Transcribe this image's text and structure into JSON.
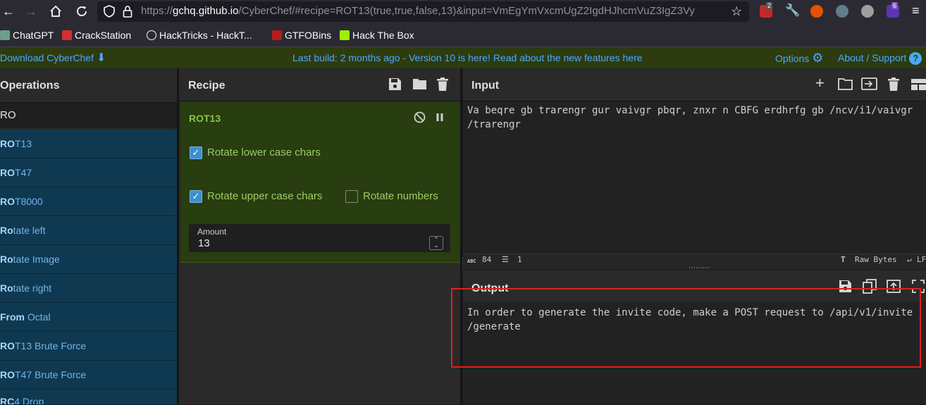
{
  "browser": {
    "url_prefix": "https://",
    "url_host": "gchq.github.io",
    "url_rest": "/CyberChef/#recipe=ROT13(true,true,false,13)&input=VmEgYmVxcmUgZ2IgdHJhcmVuZ3IgZ3Vy",
    "ext_badge_1": "2",
    "ext_badge_2": "6"
  },
  "bookmarks": [
    {
      "label": "ChatGPT"
    },
    {
      "label": "CrackStation"
    },
    {
      "label": "HackTricks - HackT..."
    },
    {
      "label": "GTFOBins"
    },
    {
      "label": "Hack The Box"
    }
  ],
  "banner": {
    "download": "Download CyberChef",
    "build_info": "Last build: 2 months ago - Version 10 is here! Read about the new features here",
    "options": "Options",
    "about": "About / Support"
  },
  "operations": {
    "title": "Operations",
    "search_value": "RO",
    "items": [
      {
        "match": "RO",
        "rest": "T13"
      },
      {
        "match": "RO",
        "rest": "T47"
      },
      {
        "match": "RO",
        "rest": "T8000"
      },
      {
        "match": "Ro",
        "rest": "tate left"
      },
      {
        "match": "Ro",
        "rest": "tate Image"
      },
      {
        "match": "Ro",
        "rest": "tate right"
      },
      {
        "match": "From ",
        "rest": "Octal"
      },
      {
        "match": "RO",
        "rest": "T13 Brute Force"
      },
      {
        "match": "RO",
        "rest": "T47 Brute Force"
      },
      {
        "match": "RC",
        "rest": "4 Drop"
      }
    ]
  },
  "recipe": {
    "title": "Recipe",
    "operation": "ROT13",
    "opt_lower": "Rotate lower case chars",
    "opt_upper": "Rotate upper case chars",
    "opt_numbers": "Rotate numbers",
    "lower_checked": true,
    "upper_checked": true,
    "numbers_checked": false,
    "amount_label": "Amount",
    "amount_value": "13"
  },
  "input": {
    "title": "Input",
    "text": "Va beqre gb trarengr gur vaivgr pbqr, znxr n CBFG erdhrfg gb /ncv/i1/vaivgr\n/trarengr",
    "char_count": "84",
    "line_count": "1",
    "raw_bytes": "Raw Bytes",
    "line_ending": "LF"
  },
  "output": {
    "title": "Output",
    "text": "In order to generate the invite code, make a POST request to /api/v1/invite\n/generate"
  },
  "colors": {
    "highlight": "#e0201d",
    "link": "#4aa9ff",
    "recipe_bg": "#283d10",
    "op_bg": "#0f3950"
  }
}
